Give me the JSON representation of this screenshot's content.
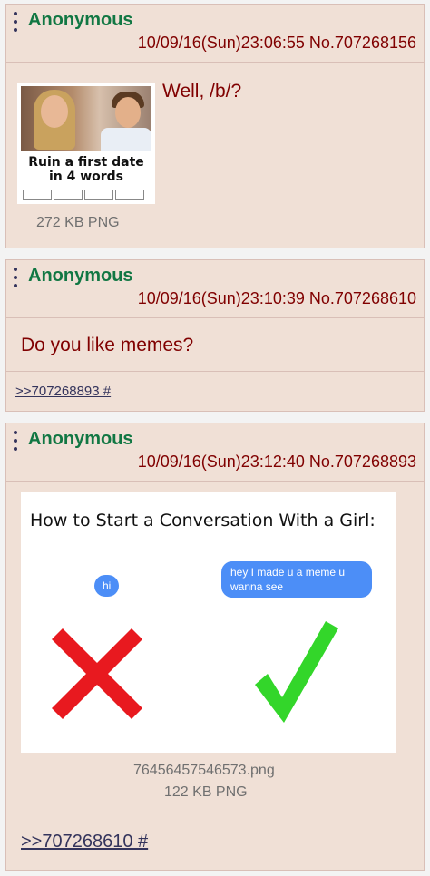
{
  "posts": [
    {
      "name": "Anonymous",
      "datetime": "10/09/16(Sun)23:06:55",
      "number": "No.707268156",
      "comment": "Well, /b/?",
      "thumbnail": {
        "caption_line1": "Ruin a first date",
        "caption_line2": "in 4 words"
      },
      "file_size": "272 KB PNG"
    },
    {
      "name": "Anonymous",
      "datetime": "10/09/16(Sun)23:10:39",
      "number": "No.707268610",
      "comment": "Do you like memes?",
      "backlink": ">>707268893 #"
    },
    {
      "name": "Anonymous",
      "datetime": "10/09/16(Sun)23:12:40",
      "number": "No.707268893",
      "image": {
        "title": "How to Start a Conversation With a Girl:",
        "bubble_left": "hi",
        "bubble_right": "hey I made u a meme u wanna see"
      },
      "file_name": "76456457546573.png",
      "file_size": "122 KB PNG",
      "backlink": ">>707268610 #"
    }
  ],
  "colors": {
    "post_bg": "#f0e0d6",
    "name": "#117743",
    "text": "#800000",
    "link": "#34345c",
    "bubble": "#4c8ef7",
    "x_mark": "#e8191f",
    "check_mark": "#33d62a"
  },
  "icons": [
    "menu-dots-icon",
    "x-mark-icon",
    "check-mark-icon"
  ]
}
